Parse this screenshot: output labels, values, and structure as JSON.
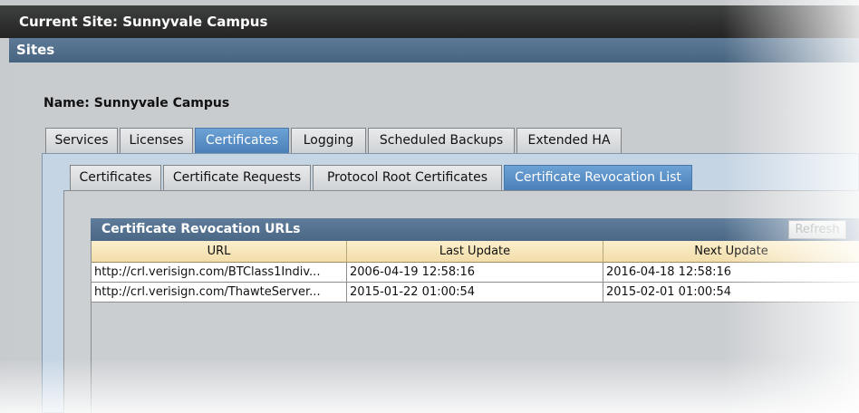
{
  "title_bar": {
    "text": "Current Site:  Sunnyvale Campus"
  },
  "sites_bar": {
    "label": "Sites"
  },
  "site_name": {
    "label": "Name:  Sunnyvale Campus"
  },
  "main_tabs": [
    {
      "label": "Services",
      "active": false
    },
    {
      "label": "Licenses",
      "active": false
    },
    {
      "label": "Certificates",
      "active": true
    },
    {
      "label": "Logging",
      "active": false
    },
    {
      "label": "Scheduled Backups",
      "active": false
    },
    {
      "label": "Extended HA",
      "active": false
    }
  ],
  "sub_tabs": [
    {
      "label": "Certificates",
      "active": false
    },
    {
      "label": "Certificate Requests",
      "active": false
    },
    {
      "label": "Protocol Root Certificates",
      "active": false
    },
    {
      "label": "Certificate Revocation List",
      "active": true
    }
  ],
  "crl_panel": {
    "title": "Certificate Revocation URLs",
    "refresh_label": "Refresh"
  },
  "crl_table": {
    "columns": [
      "URL",
      "Last Update",
      "Next Update"
    ],
    "rows": [
      [
        "http://crl.verisign.com/BTClass1Indiv...",
        "2006-04-19 12:58:16",
        "2016-04-18 12:58:16"
      ],
      [
        "http://crl.verisign.com/ThawteServer...",
        "2015-01-22 01:00:54",
        "2015-02-01 01:00:54"
      ]
    ]
  },
  "colors": {
    "title_bar": "#2e2e2e",
    "sites_bar": "#526f8c",
    "active_tab": "#4f86bf",
    "table_header": "#f6e5b8"
  }
}
